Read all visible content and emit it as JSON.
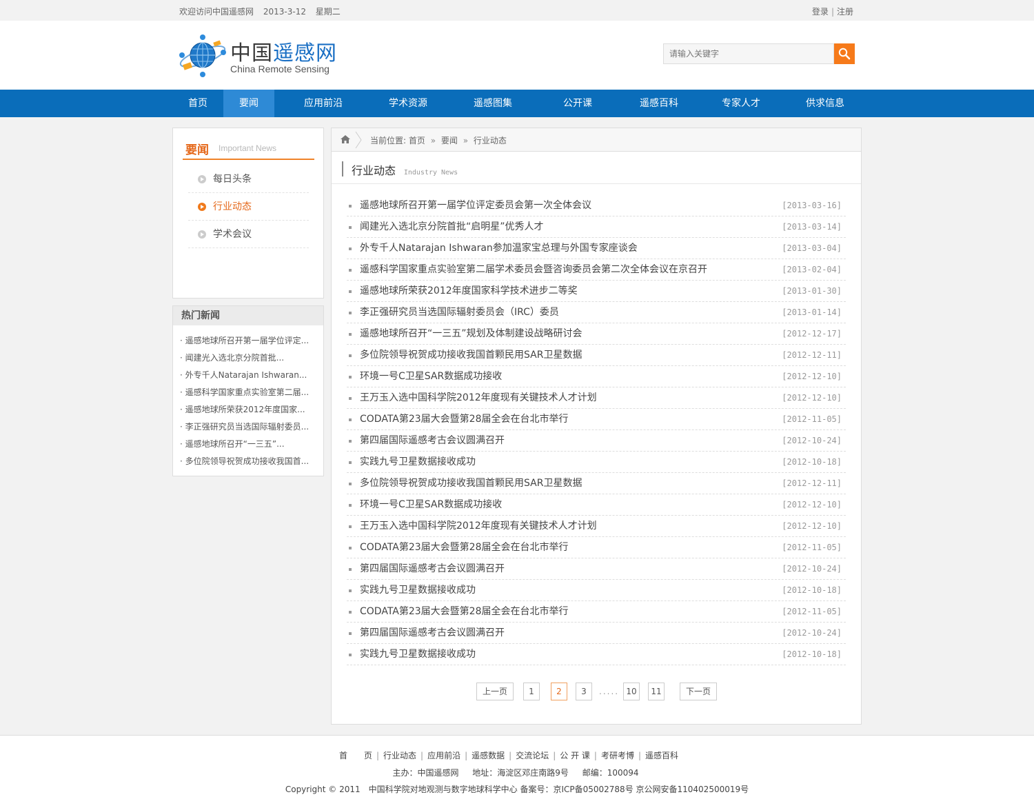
{
  "topbar": {
    "welcome": "欢迎访问中国遥感网",
    "date": "2013-3-12",
    "weekday": "星期二",
    "login": "登录",
    "register": "注册"
  },
  "header": {
    "logo_cn_1": "中国",
    "logo_cn_2": "遥感网",
    "logo_en": "China Remote Sensing",
    "search_placeholder": "请输入关键字"
  },
  "nav": [
    {
      "label": "首页"
    },
    {
      "label": "要闻",
      "active": true
    },
    {
      "label": "应用前沿"
    },
    {
      "label": "学术资源"
    },
    {
      "label": "遥感图集"
    },
    {
      "label": "公开课"
    },
    {
      "label": "遥感百科"
    },
    {
      "label": "专家人才"
    },
    {
      "label": "供求信息"
    }
  ],
  "sidebar": {
    "title_cn": "要闻",
    "title_en": "Important News",
    "items": [
      {
        "label": "每日头条"
      },
      {
        "label": "行业动态",
        "active": true
      },
      {
        "label": "学术会议"
      }
    ]
  },
  "hot": {
    "title": "热门新闻",
    "items": [
      "· 遥感地球所召开第一届学位评定...",
      "· 闻建光入选北京分院首批...",
      "· 外专千人Natarajan Ishwaran...",
      "· 遥感科学国家重点实验室第二届...",
      "· 遥感地球所荣获2012年度国家...",
      "· 李正强研究员当选国际辐射委员...",
      "· 遥感地球所召开“一三五”...",
      "· 多位院领导祝贺成功接收我国首..."
    ]
  },
  "breadcrumb": {
    "prefix": "当前位置:",
    "home": "首页",
    "sep": "»",
    "level1": "要闻",
    "level2": "行业动态"
  },
  "main": {
    "title_cn": "行业动态",
    "title_en": "Industry News",
    "news": [
      {
        "title": "遥感地球所召开第一届学位评定委员会第一次全体会议",
        "date": "[2013-03-16]"
      },
      {
        "title": "闻建光入选北京分院首批“启明星”优秀人才",
        "date": "[2013-03-14]"
      },
      {
        "title": "外专千人Natarajan Ishwaran参加温家宝总理与外国专家座谈会",
        "date": "[2013-03-04]"
      },
      {
        "title": "遥感科学国家重点实验室第二届学术委员会暨咨询委员会第二次全体会议在京召开",
        "date": "[2013-02-04]"
      },
      {
        "title": "遥感地球所荣获2012年度国家科学技术进步二等奖",
        "date": "[2013-01-30]"
      },
      {
        "title": "李正强研究员当选国际辐射委员会（IRC）委员",
        "date": "[2013-01-14]"
      },
      {
        "title": "遥感地球所召开“一三五”规划及体制建设战略研讨会",
        "date": "[2012-12-17]"
      },
      {
        "title": "多位院领导祝贺成功接收我国首颗民用SAR卫星数据",
        "date": "[2012-12-11]"
      },
      {
        "title": "环境一号C卫星SAR数据成功接收",
        "date": "[2012-12-10]"
      },
      {
        "title": "王万玉入选中国科学院2012年度现有关键技术人才计划",
        "date": "[2012-12-10]"
      },
      {
        "title": "CODATA第23届大会暨第28届全会在台北市举行",
        "date": "[2012-11-05]"
      },
      {
        "title": "第四届国际遥感考古会议圆满召开",
        "date": "[2012-10-24]"
      },
      {
        "title": "实践九号卫星数据接收成功",
        "date": "[2012-10-18]"
      },
      {
        "title": "多位院领导祝贺成功接收我国首颗民用SAR卫星数据",
        "date": "[2012-12-11]"
      },
      {
        "title": "环境一号C卫星SAR数据成功接收",
        "date": "[2012-12-10]"
      },
      {
        "title": "王万玉入选中国科学院2012年度现有关键技术人才计划",
        "date": "[2012-12-10]"
      },
      {
        "title": "CODATA第23届大会暨第28届全会在台北市举行",
        "date": "[2012-11-05]"
      },
      {
        "title": "第四届国际遥感考古会议圆满召开",
        "date": "[2012-10-24]"
      },
      {
        "title": "实践九号卫星数据接收成功",
        "date": "[2012-10-18]"
      },
      {
        "title": "CODATA第23届大会暨第28届全会在台北市举行",
        "date": "[2012-11-05]"
      },
      {
        "title": "第四届国际遥感考古会议圆满召开",
        "date": "[2012-10-24]"
      },
      {
        "title": "实践九号卫星数据接收成功",
        "date": "[2012-10-18]"
      }
    ]
  },
  "pager": {
    "prev": "上一页",
    "pages": [
      "1",
      "2",
      "3"
    ],
    "current": "2",
    "ellipsis": ".....",
    "tail": [
      "10",
      "11"
    ],
    "next": "下一页"
  },
  "footer": {
    "links": [
      "首　　页",
      "行业动态",
      "应用前沿",
      "遥感数据",
      "交流论坛",
      "公 开 课",
      "考研考博",
      "遥感百科"
    ],
    "host": "主办：中国遥感网",
    "address": "地址：海淀区邓庄南路9号",
    "postcode": "邮编：100094",
    "copyright": "Copyright © 2011　中国科学院对地观测与数字地球科学中心 备案号：京ICP备05002788号 京公网安备110402500019号"
  },
  "colors": {
    "nav_bg": "#0a6dba",
    "nav_active": "#2e8ad6",
    "accent_orange": "#e5681a",
    "search_button": "#f67a1a"
  }
}
